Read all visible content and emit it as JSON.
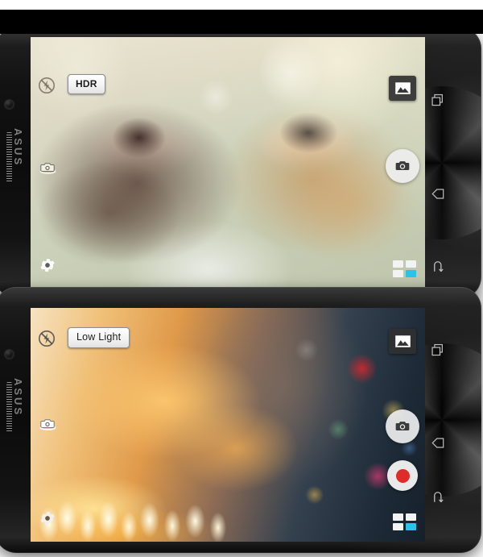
{
  "page": {
    "title": "ASUS ZenFone 2 camera modes",
    "brand": "ASUS",
    "accent_cyan": "#29c3e8",
    "record_red": "#e02b2b"
  },
  "devices": [
    {
      "id": "top-device",
      "mode_label": "HDR",
      "photo_description": "Two laughing women wearing sunglasses in warm backlit sunlight",
      "controls": {
        "flash_icon": "flash-off-icon",
        "switch_camera_icon": "switch-camera-icon",
        "settings_icon": "settings-gear-icon",
        "gallery_icon": "gallery-thumbnail-icon",
        "shutter_icon": "camera-shutter-icon",
        "modes_icon": "mode-grid-icon",
        "has_record_button": false
      },
      "nav": [
        {
          "name": "recents-icon",
          "label": "Recents"
        },
        {
          "name": "back-icon",
          "label": "Back"
        },
        {
          "name": "return-icon",
          "label": "Return"
        }
      ]
    },
    {
      "id": "bottom-device",
      "mode_label": "Low Light",
      "photo_description": "Young girl resting her chin on her hand behind glowing birthday candles",
      "controls": {
        "flash_icon": "flash-off-icon",
        "switch_camera_icon": "switch-camera-icon",
        "settings_icon": "settings-gear-icon",
        "gallery_icon": "gallery-thumbnail-icon",
        "shutter_icon": "camera-shutter-icon",
        "record_icon": "video-record-icon",
        "modes_icon": "mode-grid-icon",
        "has_record_button": true
      },
      "nav": [
        {
          "name": "recents-icon",
          "label": "Recents"
        },
        {
          "name": "back-icon",
          "label": "Back"
        },
        {
          "name": "return-icon",
          "label": "Return"
        }
      ]
    }
  ]
}
